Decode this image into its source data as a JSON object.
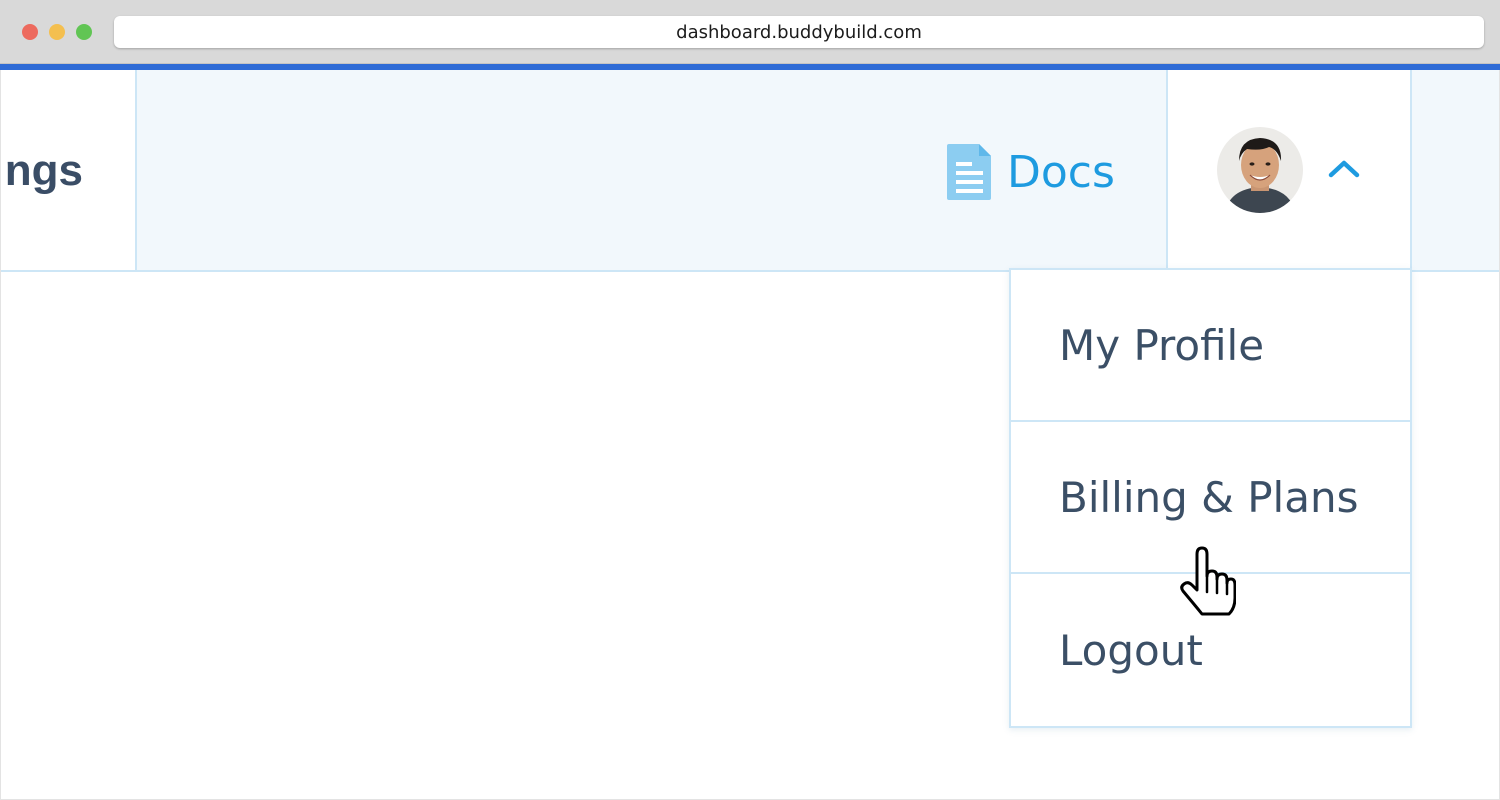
{
  "browser": {
    "url": "dashboard.buddybuild.com"
  },
  "navbar": {
    "settings_label": "ngs",
    "docs": {
      "label": "Docs",
      "icon": "document-icon",
      "color": "#1e9be0"
    },
    "user_menu": {
      "avatar": "user-avatar",
      "toggle_icon": "chevron-up-icon",
      "expanded": true
    }
  },
  "dropdown": {
    "items": [
      {
        "label": "My Profile"
      },
      {
        "label": "Billing & Plans"
      },
      {
        "label": "Logout"
      }
    ]
  },
  "colors": {
    "accent_bar": "#2e6bd6",
    "nav_background": "#f2f8fc",
    "border": "#cde6f6",
    "text": "#3b4f66"
  },
  "pointer": {
    "icon": "hand-pointer-icon",
    "hovered_item": "Billing & Plans"
  }
}
